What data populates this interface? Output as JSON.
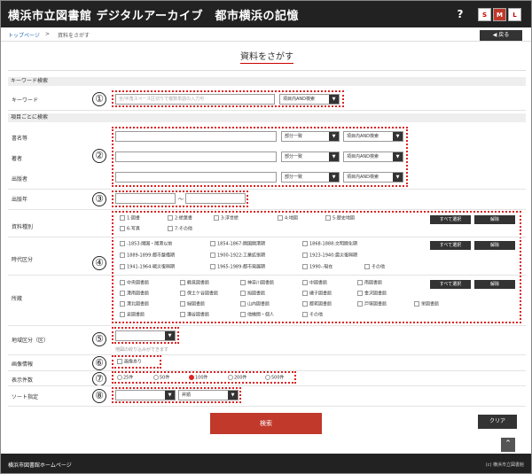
{
  "header": {
    "title": "横浜市立図書館 デジタルアーカイブ　都市横浜の記憶",
    "help": "?",
    "size_s": "S",
    "size_m": "M",
    "size_l": "L"
  },
  "breadcrumb": {
    "home": "トップページ",
    "sep": ">",
    "current": "資料をさがす"
  },
  "back_button": "◀ 戻る",
  "page_title": "資料をさがす",
  "keyword_section": {
    "heading": "キーワード検索",
    "label": "キーワード",
    "placeholder": "全/半角スペース区切りで複数単語の入力可",
    "mode": "項目内AND検索"
  },
  "item_section": {
    "heading": "項目ごとに検索",
    "rows": [
      {
        "label": "書名等",
        "match": "部分一致",
        "mode": "項目内AND検索"
      },
      {
        "label": "著者",
        "match": "部分一致",
        "mode": "項目内AND検索"
      },
      {
        "label": "出版者",
        "match": "部分一致",
        "mode": "項目内AND検索"
      }
    ],
    "year_label": "出版年",
    "year_sep": "～"
  },
  "material_type": {
    "label": "資料種別",
    "options": [
      "1:図書",
      "2:絵葉書",
      "3:浮世絵",
      "4:地図",
      "5:歴史地図",
      "6:写真",
      "7:その他"
    ]
  },
  "period": {
    "label": "時代区分",
    "options": [
      "-1853:開国・開港以前",
      "1854-1867:開国開港期",
      "1868-1888:文明開化期",
      "1889-1899:都市整備期",
      "1900-1922:工業拡張期",
      "1923-1940:震災復興期",
      "1941-1964:戦災復興期",
      "1965-1989:都市発展期",
      "1990-:現在",
      "その他"
    ]
  },
  "holding": {
    "label": "所蔵",
    "options": [
      "中央図書館",
      "鶴見図書館",
      "神奈川図書館",
      "中図書館",
      "南図書館",
      "港南図書館",
      "保土ケ谷図書館",
      "旭図書館",
      "磯子図書館",
      "金沢図書館",
      "港北図書館",
      "緑図書館",
      "山内図書館",
      "都筑図書館",
      "戸塚図書館",
      "栄図書館",
      "泉図書館",
      "瀬谷図書館",
      "他機関・個人",
      "その他"
    ]
  },
  "buttons": {
    "select_all": "すべて選択",
    "clear": "解除",
    "search": "検索",
    "reset": "クリア"
  },
  "region": {
    "label": "地域区分（区）",
    "hint": "地図の絞り込みができます"
  },
  "image": {
    "label": "画像情報",
    "option": "画像あり"
  },
  "per_page": {
    "label": "表示件数",
    "options": [
      "25件",
      "50件",
      "100件",
      "200件",
      "500件"
    ],
    "selected": "100件"
  },
  "sort": {
    "label": "ソート指定",
    "order": "昇順"
  },
  "markers": [
    "①",
    "②",
    "③",
    "④",
    "⑤",
    "⑥",
    "⑦",
    "⑧"
  ],
  "footer": {
    "left": "横浜市図書館ホームページ",
    "right": "(c) 横浜市立図書館"
  },
  "colors": {
    "header": "#222222",
    "accent": "#c0392b",
    "marker": "#dd2222"
  }
}
